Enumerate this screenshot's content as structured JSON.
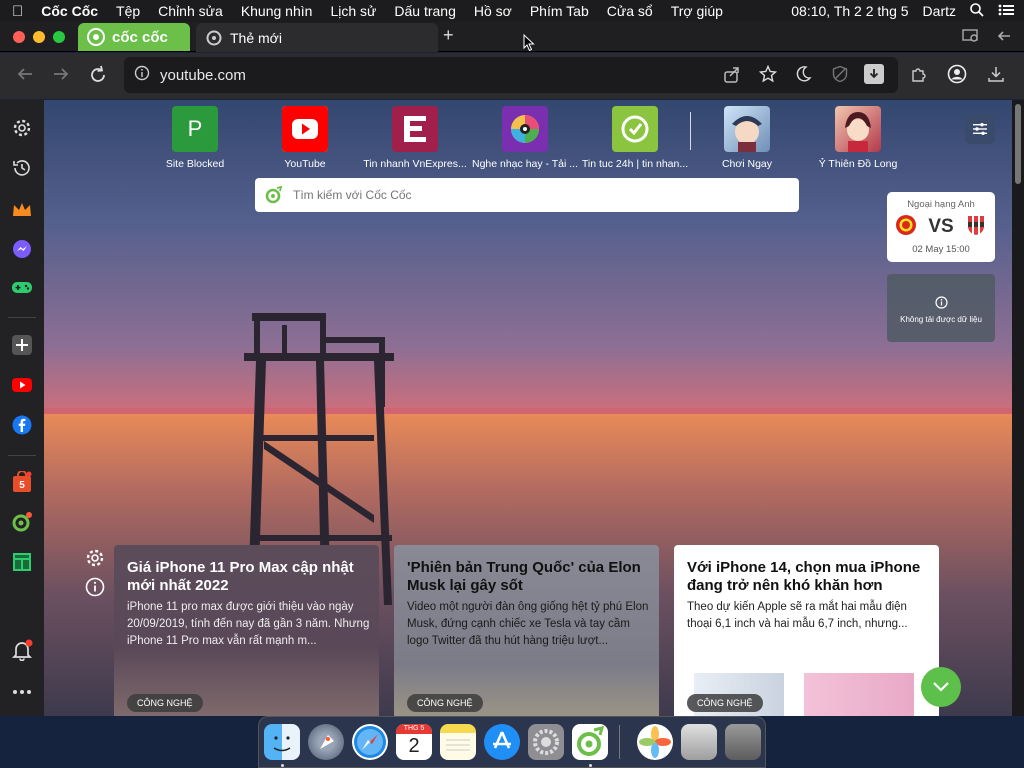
{
  "menubar": {
    "app_name": "Cốc Cốc",
    "items": [
      "Tệp",
      "Chỉnh sửa",
      "Khung nhìn",
      "Lịch sử",
      "Dấu trang",
      "Hồ sơ",
      "Phím Tab",
      "Cửa sổ",
      "Trợ giúp"
    ],
    "clock": "08:10, Th 2 2 thg 5",
    "user": "Dartz"
  },
  "tabs": {
    "logo_text": "cốc cốc",
    "active_title": "Thẻ mới"
  },
  "address": {
    "url": "youtube.com"
  },
  "shortcuts": [
    {
      "label": "Site Blocked",
      "icon": "p-letter-icon"
    },
    {
      "label": "YouTube",
      "icon": "youtube-icon"
    },
    {
      "label": "Tin nhanh VnExpres...",
      "icon": "vnexpress-icon"
    },
    {
      "label": "Nghe nhạc hay - Tải ...",
      "icon": "music-icon"
    },
    {
      "label": "Tin tuc 24h | tin nhan...",
      "icon": "news24h-icon"
    },
    {
      "label": "Chơi Ngay",
      "icon": "game-icon"
    },
    {
      "label": "Ỷ Thiên Đồ Long",
      "icon": "game2-icon"
    }
  ],
  "search": {
    "placeholder": "Tìm kiếm với Cốc Cốc"
  },
  "match_widget": {
    "league": "Ngoại hạng Anh",
    "vs": "VS",
    "time": "02 May 15:00"
  },
  "error_widget": {
    "message": "Không tải được dữ liệu"
  },
  "news": [
    {
      "title": "Giá iPhone 11 Pro Max cập nhật mới nhất 2022",
      "desc": "iPhone 11 pro max được giới thiệu vào ngày 20/09/2019, tính đến nay đã gần 3 năm. Nhưng iPhone 11 Pro max vẫn rất mạnh m...",
      "tag": "CÔNG NGHỆ"
    },
    {
      "title": "'Phiên bản Trung Quốc' của Elon Musk lại gây sốt",
      "desc": "Video một người đàn ông giống hệt tỷ phú Elon Musk, đứng cạnh chiếc xe Tesla và tay cầm logo Twitter đã thu hút hàng triệu lượt...",
      "tag": "CÔNG NGHỆ"
    },
    {
      "title": "Với iPhone 14, chọn mua iPhone đang trở nên khó khăn hơn",
      "desc": "Theo dự kiến Apple sẽ ra mắt hai mẫu điện thoại 6,1 inch và hai mẫu 6,7 inch, nhưng...",
      "tag": "CÔNG NGHỆ"
    }
  ],
  "dock": {
    "calendar_month": "THG 5",
    "calendar_day": "2"
  },
  "colors": {
    "brand_green": "#6cc04a",
    "menubar_bg": "#1c1c1e",
    "toolbar_bg": "#2c2c2e"
  }
}
